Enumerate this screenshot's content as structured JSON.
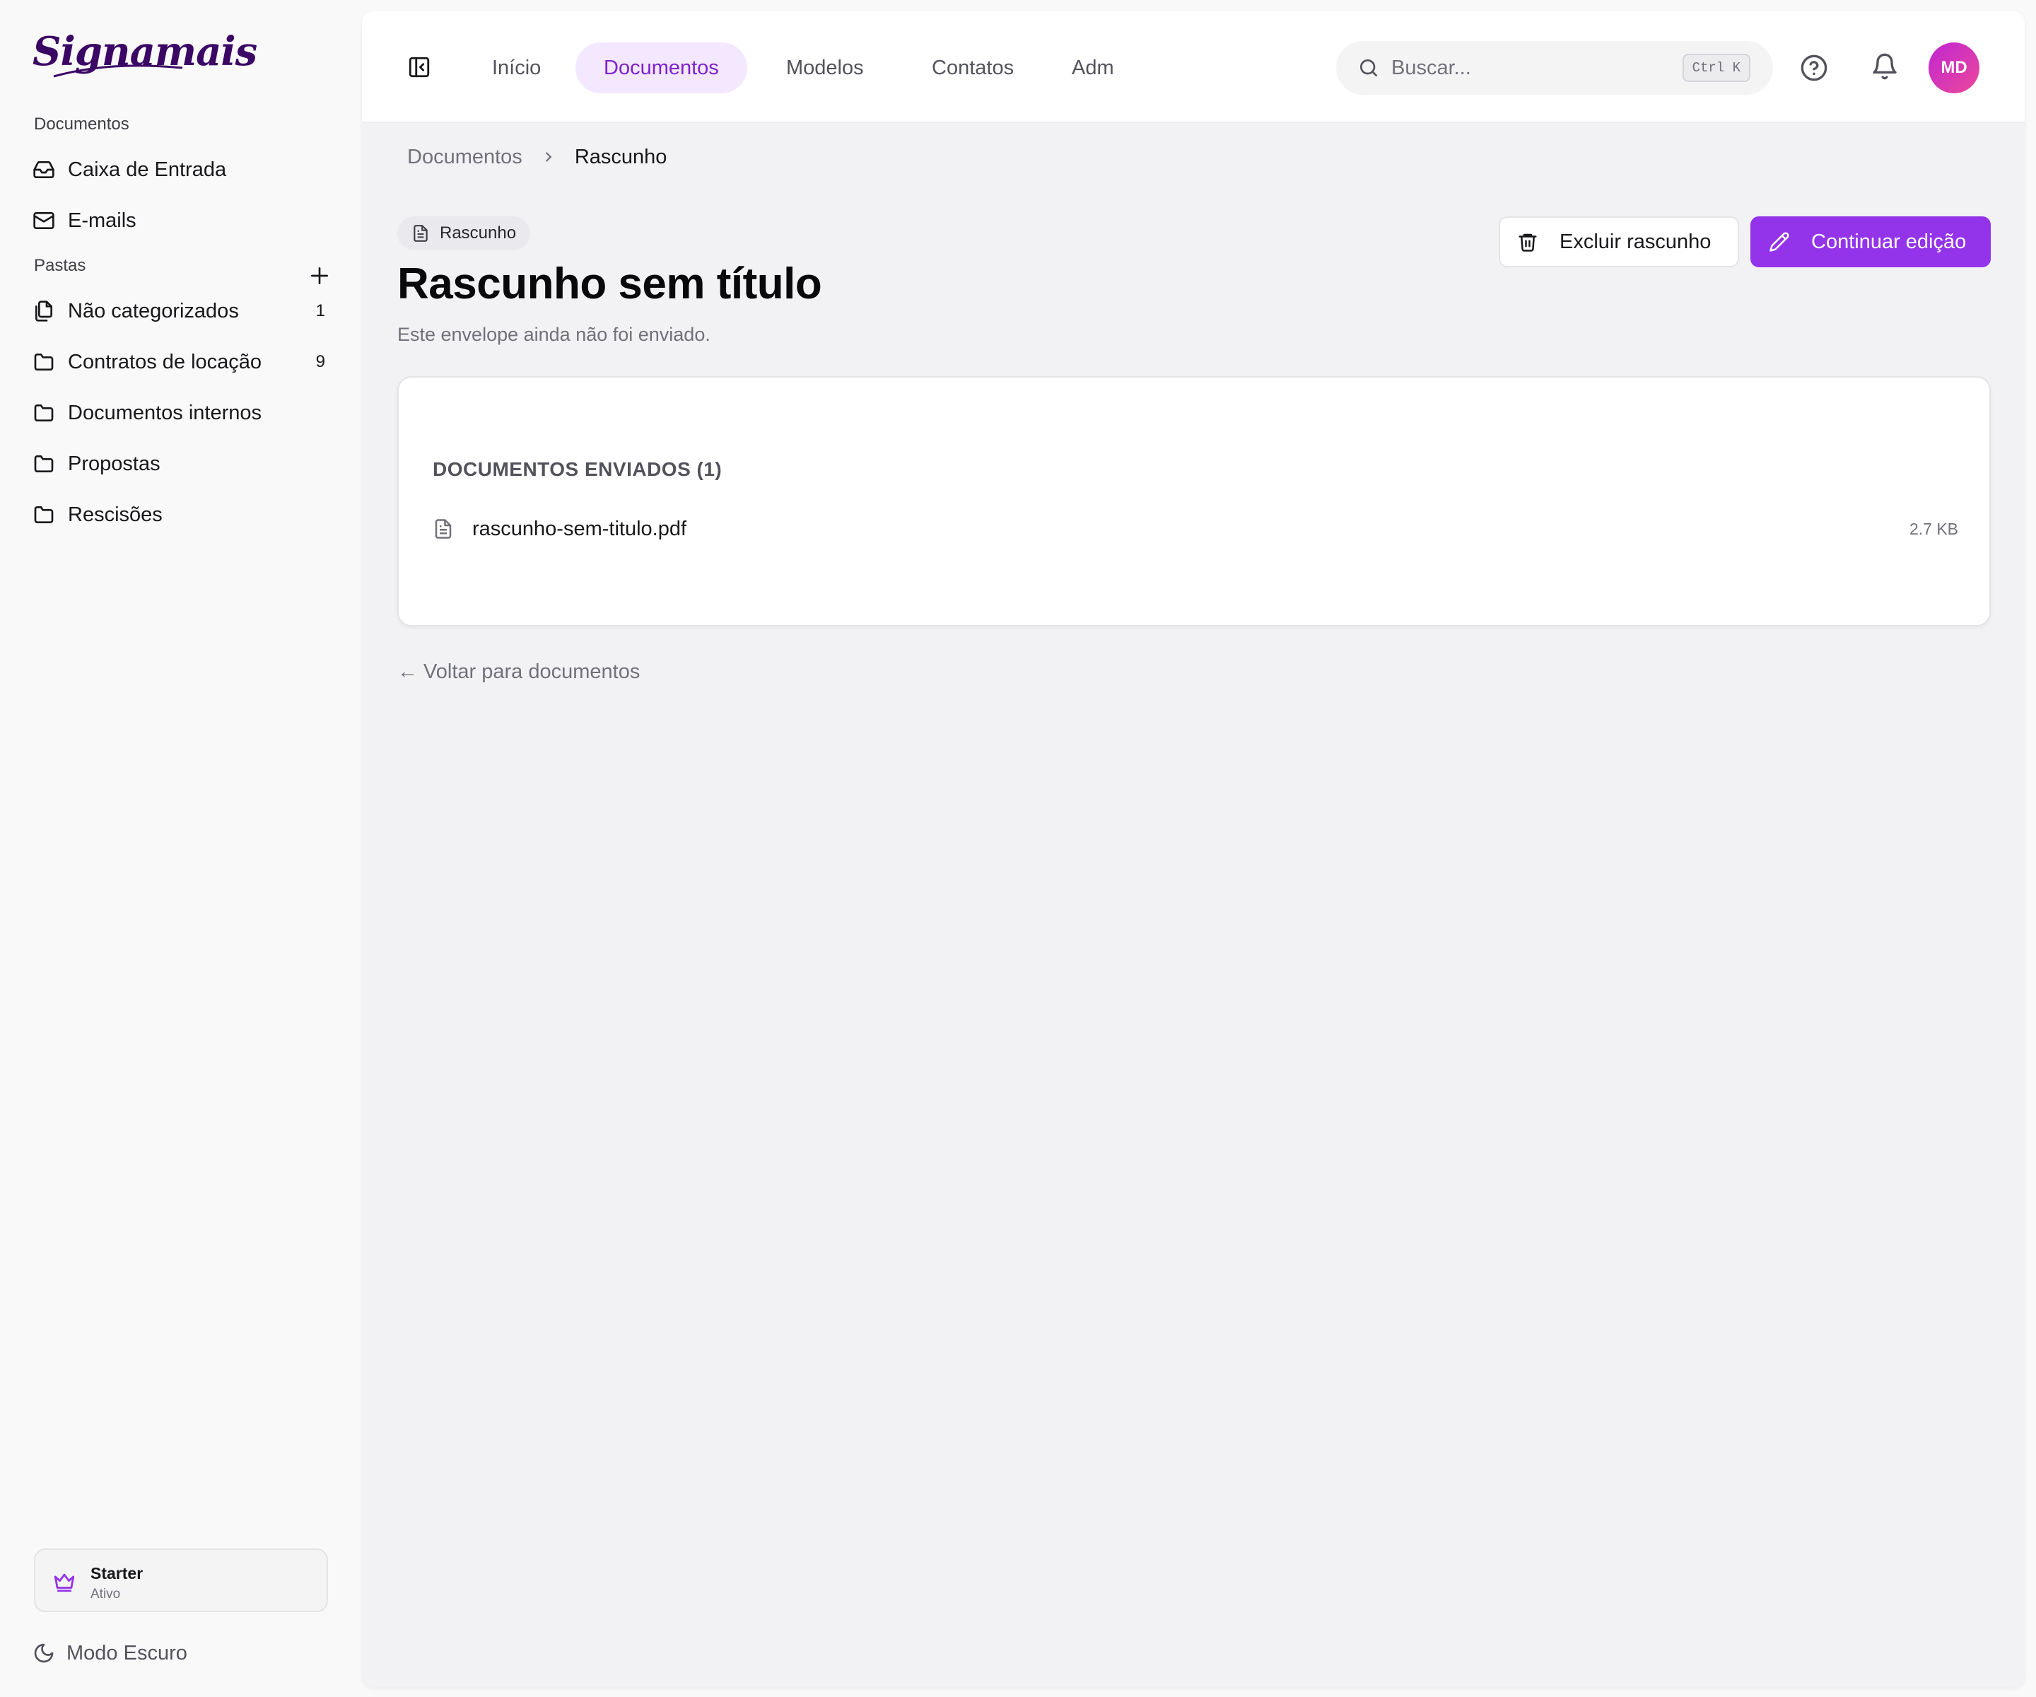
{
  "brand": {
    "logo_text": "Signamais"
  },
  "sidebar": {
    "documents_section": "Documentos",
    "documents_items": [
      {
        "label": "Caixa de Entrada",
        "icon": "inbox-icon"
      },
      {
        "label": "E-mails",
        "icon": "mail-icon"
      }
    ],
    "folders_section": "Pastas",
    "folders": [
      {
        "label": "Não categorizados",
        "count": "1",
        "icon": "files-icon"
      },
      {
        "label": "Contratos de locação",
        "count": "9",
        "icon": "folder-icon"
      },
      {
        "label": "Documentos internos",
        "count": "",
        "icon": "folder-icon"
      },
      {
        "label": "Propostas",
        "count": "",
        "icon": "folder-icon"
      },
      {
        "label": "Rescisões",
        "count": "",
        "icon": "folder-icon"
      }
    ],
    "plan": {
      "name": "Starter",
      "status": "Ativo",
      "icon": "crown-icon"
    },
    "dark_mode_label": "Modo Escuro"
  },
  "topbar": {
    "tabs": [
      {
        "label": "Início",
        "active": false
      },
      {
        "label": "Documentos",
        "active": true
      },
      {
        "label": "Modelos",
        "active": false
      },
      {
        "label": "Contatos",
        "active": false
      },
      {
        "label": "Adm",
        "active": false
      }
    ],
    "search": {
      "placeholder": "Buscar...",
      "shortcut": "Ctrl K"
    },
    "avatar_initials": "MD"
  },
  "breadcrumb": {
    "root": "Documentos",
    "current": "Rascunho"
  },
  "envelope": {
    "status": "Rascunho",
    "title": "Rascunho sem título",
    "subtitle": "Este envelope ainda não foi enviado.",
    "delete_label": "Excluir rascunho",
    "continue_label": "Continuar edição"
  },
  "documents": {
    "heading": "DOCUMENTOS ENVIADOS (1)",
    "files": [
      {
        "name": "rascunho-sem-titulo.pdf",
        "size": "2.7 KB"
      }
    ]
  },
  "back_link": "← Voltar para documentos",
  "colors": {
    "accent": "#9333ea",
    "accent_soft": "#f3e8ff",
    "brand": "#3b0764"
  }
}
